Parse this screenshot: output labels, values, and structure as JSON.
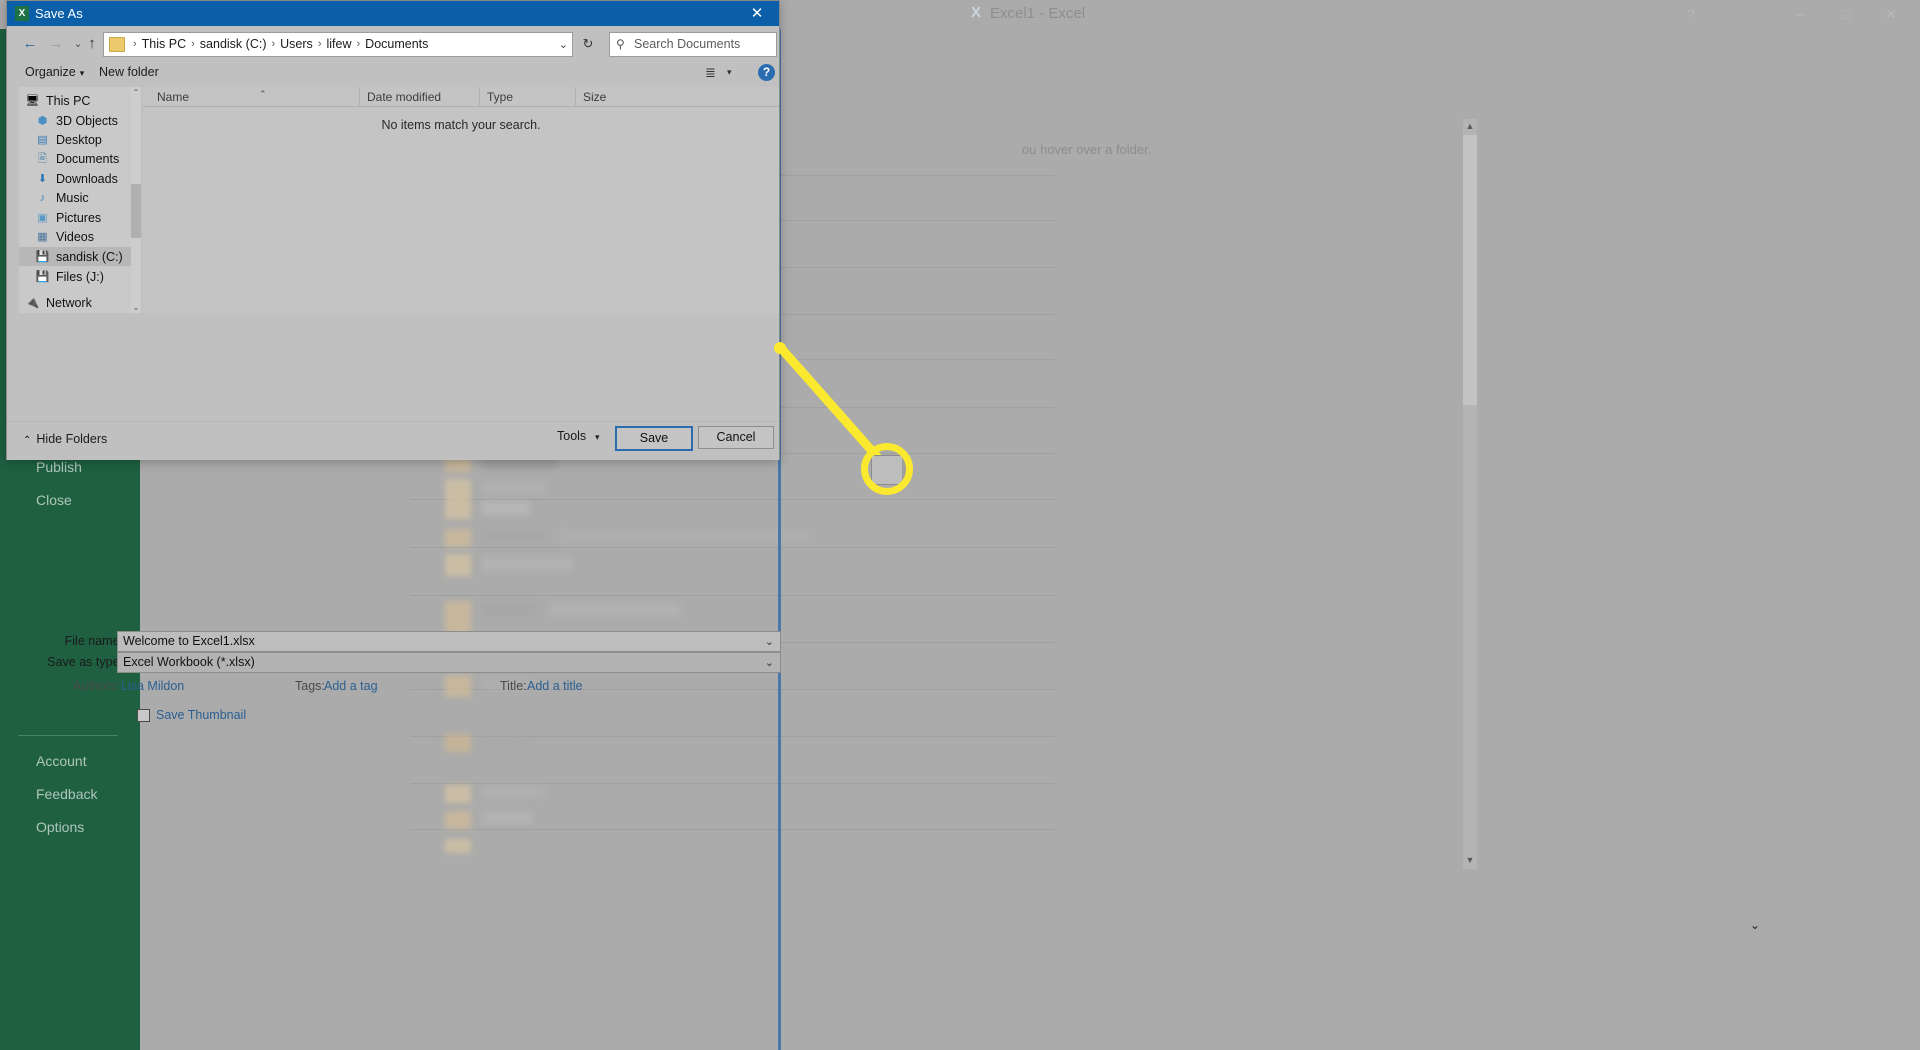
{
  "excel_window": {
    "title": "Excel1 - Excel",
    "app_badge": "X",
    "controls": {
      "account_icon": "person-icon",
      "help_icon": "?",
      "ribbon_icon": "ribbon-display-icon",
      "minimize": "─",
      "maximize": "□",
      "close": "✕"
    }
  },
  "backstage": {
    "items": [
      {
        "label": "Publish"
      },
      {
        "label": "Close"
      },
      {
        "label": "Account"
      },
      {
        "label": "Feedback"
      },
      {
        "label": "Options"
      }
    ]
  },
  "document": {
    "hint_text": "ou hover over a folder.",
    "scroll_up": "▲",
    "scroll_down": "▼"
  },
  "dialog": {
    "title": "Save As",
    "icon": "X",
    "close_label": "✕",
    "nav": {
      "back": "←",
      "forward": "→",
      "recent": "⌄",
      "up": "↑",
      "refresh": "↻",
      "address_dropdown": "⌄"
    },
    "breadcrumbs": [
      "This PC",
      "sandisk (C:)",
      "Users",
      "lifew",
      "Documents"
    ],
    "breadcrumb_separator": "›",
    "search": {
      "placeholder": "Search Documents",
      "icon": "search-icon"
    },
    "toolbar": {
      "organize": "Organize",
      "organize_caret": "▾",
      "new_folder": "New folder",
      "view_icon": "≣",
      "view_caret": "▾",
      "help": "?"
    },
    "tree": [
      {
        "label": "This PC",
        "icon": "computer-icon",
        "root": true,
        "selected": false
      },
      {
        "label": "3D Objects",
        "icon": "cube-icon",
        "root": false,
        "selected": false
      },
      {
        "label": "Desktop",
        "icon": "desktop-icon",
        "root": false,
        "selected": false
      },
      {
        "label": "Documents",
        "icon": "documents-icon",
        "root": false,
        "selected": false
      },
      {
        "label": "Downloads",
        "icon": "download-icon",
        "root": false,
        "selected": false
      },
      {
        "label": "Music",
        "icon": "music-icon",
        "root": false,
        "selected": false
      },
      {
        "label": "Pictures",
        "icon": "pictures-icon",
        "root": false,
        "selected": false
      },
      {
        "label": "Videos",
        "icon": "videos-icon",
        "root": false,
        "selected": false
      },
      {
        "label": "sandisk (C:)",
        "icon": "drive-icon",
        "root": false,
        "selected": true
      },
      {
        "label": "Files (J:)",
        "icon": "drive-icon",
        "root": false,
        "selected": false
      },
      {
        "label": "Network",
        "icon": "network-icon",
        "root": true,
        "selected": false
      }
    ],
    "tree_scroll": {
      "up": "⌃",
      "down": "⌄"
    },
    "file_list": {
      "columns": [
        "Name",
        "Date modified",
        "Type",
        "Size"
      ],
      "sort_arrow": "⌃",
      "empty_message": "No items match your search."
    },
    "form": {
      "file_name_label": "File name:",
      "file_name_value": "Welcome to Excel1.xlsx",
      "save_type_label": "Save as type:",
      "save_type_value": "Excel Workbook (*.xlsx)",
      "combo_caret": "⌄",
      "authors_label": "Authors:",
      "authors_value": "Lisa Mildon",
      "tags_label": "Tags:",
      "tags_value": "Add a tag",
      "title_label": "Title:",
      "title_value": "Add a title",
      "thumbnail_label": "Save Thumbnail"
    },
    "footer": {
      "hide_folders": "Hide Folders",
      "hide_folders_caret": "⌃",
      "tools": "Tools",
      "tools_caret": "▾",
      "save": "Save",
      "cancel": "Cancel"
    }
  },
  "annotation": {
    "highlight_color": "#fbe930",
    "target_caret": "⌄"
  }
}
